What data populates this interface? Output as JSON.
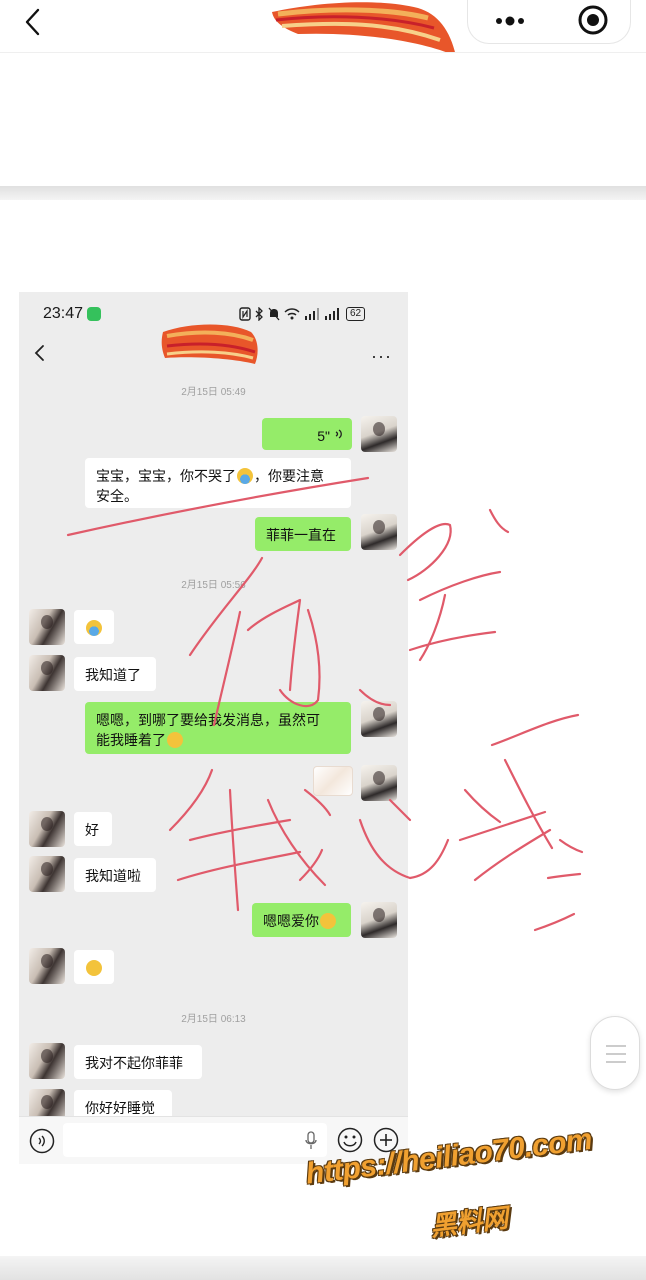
{
  "nav": {
    "back_icon": "back-arrow-icon",
    "more_icon": "more-dots-icon",
    "close_icon": "target-circle-icon"
  },
  "chat": {
    "status_bar": {
      "time": "23:47",
      "battery": "62"
    },
    "header": {
      "back_icon": "chevron-left-icon",
      "more_label": "···"
    },
    "timestamps": [
      "2月15日 05:49",
      "2月15日 05:56",
      "2月15日 06:13"
    ],
    "messages": [
      {
        "from": "me",
        "text": "5\"",
        "type": "voice"
      },
      {
        "from": "me",
        "text_a": "宝宝，宝宝，你不哭了",
        "text_b": "，你要注意",
        "text_c": "安全。"
      },
      {
        "from": "me",
        "text": "菲菲一直在"
      },
      {
        "from": "her",
        "type": "emoji"
      },
      {
        "from": "her",
        "text": "我知道了"
      },
      {
        "from": "me",
        "text_a": "嗯嗯，到哪了要给我发消息，虽然可",
        "text_b": "能我睡着了"
      },
      {
        "from": "me",
        "type": "sticker"
      },
      {
        "from": "her",
        "text": "好"
      },
      {
        "from": "her",
        "text": "我知道啦"
      },
      {
        "from": "me",
        "text": "嗯嗯爱你"
      },
      {
        "from": "her",
        "type": "emoji"
      },
      {
        "from": "her",
        "text": "我对不起你菲菲"
      },
      {
        "from": "her",
        "text": "你好好睡觉"
      }
    ],
    "input_bar": {
      "voice_icon": "voice-icon",
      "emoji_icon": "smile-icon",
      "plus_icon": "plus-circle-icon",
      "mic_icon": "mic-icon"
    }
  },
  "watermark": {
    "url": "https://heiliao70.com",
    "name": "黑料网"
  },
  "colors": {
    "bubble_me": "#95ec69",
    "bubble_her": "#ffffff",
    "ink": "#e05a6a",
    "watermark": "#f0a030"
  }
}
